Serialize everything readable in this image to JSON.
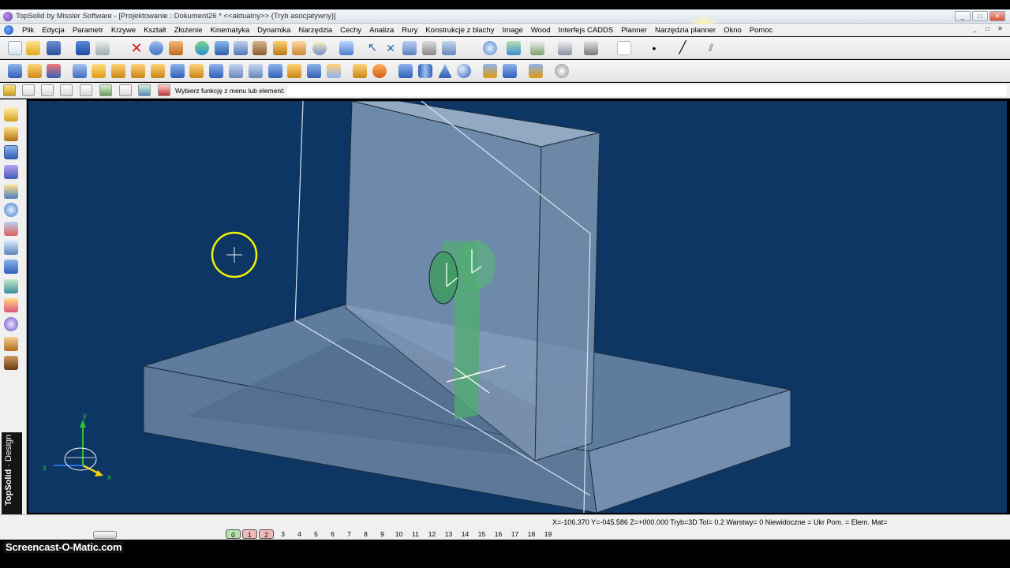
{
  "window": {
    "title": "TopSolid by Missler Software - [Projektowanie : Dokument26 *  <<aktualny>> (Tryb asocjatywny)]",
    "buttons": [
      "_",
      "□",
      "✕"
    ]
  },
  "menubar": {
    "items": [
      "Plik",
      "Edycja",
      "Parametr",
      "Krzywe",
      "Kształt",
      "Złożenie",
      "Kinematyka",
      "Dynamika",
      "Narzędzia",
      "Cechy",
      "Analiza",
      "Rury",
      "Konstrukcje z blachy",
      "Image",
      "Wood",
      "Interfejs CADDS",
      "Planner",
      "Narzędzia planner",
      "Okno",
      "Pomoc"
    ],
    "mdi_buttons": [
      "_",
      "□",
      "✕"
    ]
  },
  "command_bar": {
    "prompt": "Wybierz funkcję z menu lub element:",
    "value": ""
  },
  "sidebar": {
    "brand": "TopSolid",
    "brand_sub": "Design"
  },
  "viewport": {
    "background": "#0d3665",
    "axes": {
      "x": "x",
      "y": "y",
      "z": "z"
    }
  },
  "statusbar": {
    "coords": "X=-106.370   Y=-045.586   Z=+000.000  Tryb=3D  Tol=  0.2    Warstwy=  0    Niewidoczne = Ukr  Pom. = Elem.  Mat=",
    "pages": [
      "0",
      "1",
      "2",
      "3",
      "4",
      "5",
      "6",
      "7",
      "8",
      "9",
      "10",
      "11",
      "12",
      "13",
      "14",
      "15",
      "16",
      "17",
      "18",
      "19"
    ]
  },
  "watermark": "Screencast-O-Matic.com",
  "icons": {
    "toolbar1": [
      "new-file-icon",
      "open-file-icon",
      "save-icon",
      "info-icon",
      "print-icon",
      "delete-icon",
      "undo-icon",
      "eraser-icon",
      "regenerate-icon",
      "search-icon",
      "edit-icon",
      "tools-icon",
      "hammer-icon",
      "hand-icon",
      "inspect-icon",
      "cursor-icon",
      "zoom-icon",
      "fit-view-icon",
      "layers-icon",
      "render-icon",
      "line-style-icon",
      "hatch-icon"
    ],
    "toolbar2": [
      "shape-box-icon",
      "shape-extrude-icon",
      "shape-revolve-icon",
      "shape-drill-icon",
      "shape-boss-icon",
      "shape-pocket-icon",
      "shape-fillet-icon",
      "shape-chamfer-icon",
      "shape-shell-icon",
      "shape-draft-icon",
      "shape-cut-icon",
      "shape-sweep-icon",
      "shape-loft-icon",
      "shape-rib-icon",
      "shape-thread-icon",
      "shape-pattern-icon",
      "shape-mirror-icon",
      "cube-icon",
      "cylinder-icon",
      "cone-icon",
      "sphere-icon",
      "view-front-icon",
      "view-top-icon",
      "view-iso-icon",
      "settings-icon"
    ]
  },
  "colors": {
    "viewport_bg": "#0d3665",
    "cursor_circle": "#f2f200",
    "part_green": "#4fae6e",
    "face_light": "#9eb4cc"
  }
}
